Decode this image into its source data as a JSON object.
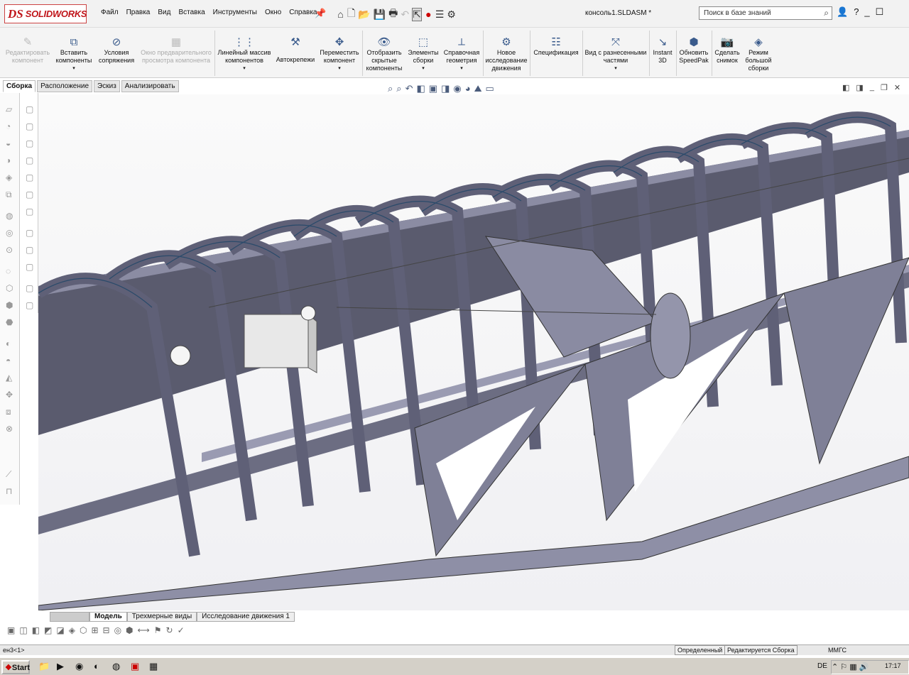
{
  "app": {
    "logo_ds": "DS",
    "logo_name": "SOLIDWORKS",
    "document_title": "консоль1.SLDASM *"
  },
  "menu": [
    "Файл",
    "Правка",
    "Вид",
    "Вставка",
    "Инструменты",
    "Окно",
    "Справка"
  ],
  "quick_access_icons": [
    "home-icon",
    "new-document-icon",
    "open-icon",
    "save-icon",
    "print-icon",
    "undo-icon",
    "select-icon",
    "rebuild-icon",
    "options-icon",
    "gear-icon"
  ],
  "search": {
    "placeholder": "Поиск в базе знаний"
  },
  "window_controls": [
    "user-icon",
    "help-icon",
    "minimize-icon",
    "maximize-icon"
  ],
  "ribbon": [
    {
      "label": "Редактировать компонент",
      "icon": "edit-component-icon",
      "disabled": true
    },
    {
      "label": "Вставить компоненты",
      "icon": "insert-components-icon"
    },
    {
      "label": "Условия сопряжения",
      "icon": "mate-icon"
    },
    {
      "label": "Окно предварительного просмотра компонента",
      "icon": "preview-icon",
      "disabled": true
    },
    {
      "label": "Линейный массив компонентов",
      "icon": "linear-pattern-icon"
    },
    {
      "label": "Автокрепежи",
      "icon": "fasteners-icon"
    },
    {
      "label": "Переместить компонент",
      "icon": "move-component-icon"
    },
    {
      "label": "Отобразить скрытые компоненты",
      "icon": "show-hidden-icon"
    },
    {
      "label": "Элементы сборки",
      "icon": "assembly-features-icon"
    },
    {
      "label": "Справочная геометрия",
      "icon": "reference-geometry-icon"
    },
    {
      "label": "Новое исследование движения",
      "icon": "motion-study-icon"
    },
    {
      "label": "Спецификация",
      "icon": "bom-icon"
    },
    {
      "label": "Вид с разнесенными частями",
      "icon": "exploded-view-icon"
    },
    {
      "label": "Instant 3D",
      "icon": "instant3d-icon"
    },
    {
      "label": "Обновить SpeedPak",
      "icon": "speedpak-icon"
    },
    {
      "label": "Сделать снимок",
      "icon": "snapshot-icon"
    },
    {
      "label": "Режим большой сборки",
      "icon": "large-assembly-icon"
    }
  ],
  "command_tabs": [
    "Сборка",
    "Расположение",
    "Эскиз",
    "Анализировать"
  ],
  "bottom_tabs": [
    "Модель",
    "Трехмерные виды",
    "Исследование движения 1"
  ],
  "status": {
    "left": "ен3<1>",
    "defined": "Определенный",
    "editing": "Редактируется Сборка",
    "units": "ММГС"
  },
  "taskbar": {
    "start": "Start",
    "lang": "DE",
    "clock": "17:17"
  }
}
